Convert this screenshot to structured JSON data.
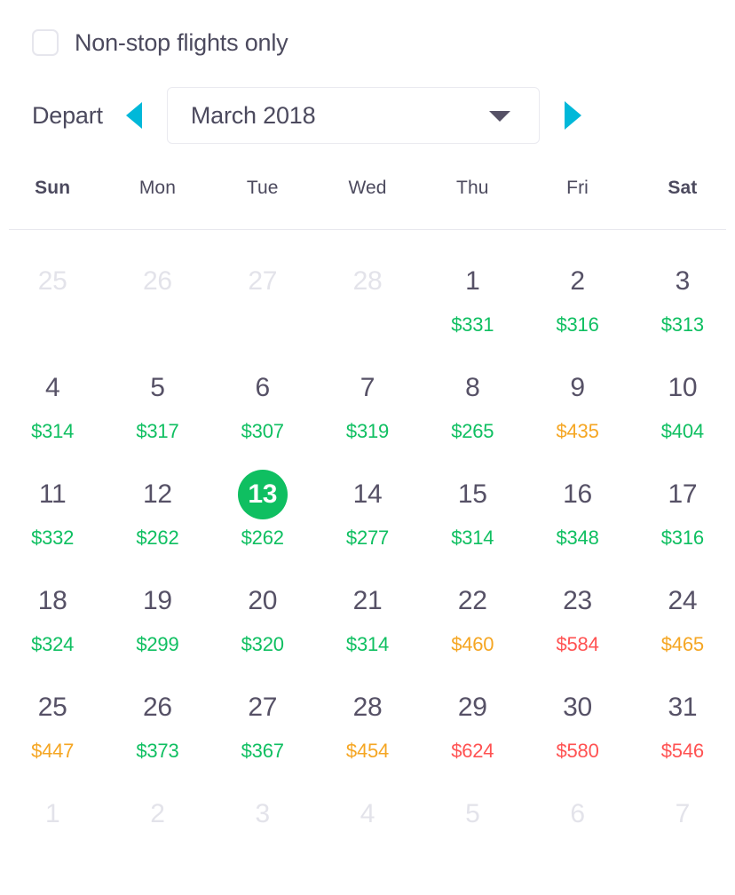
{
  "filters": {
    "nonstop": {
      "label": "Non-stop flights only",
      "checked": false
    }
  },
  "nav": {
    "depart_label": "Depart",
    "prev_icon": "triangle-left-icon",
    "next_icon": "triangle-right-icon",
    "month_value": "March 2018",
    "caret_icon": "chevron-down-icon"
  },
  "calendar": {
    "weekdays": [
      {
        "label": "Sun",
        "weekend": true
      },
      {
        "label": "Mon",
        "weekend": false
      },
      {
        "label": "Tue",
        "weekend": false
      },
      {
        "label": "Wed",
        "weekend": false
      },
      {
        "label": "Thu",
        "weekend": false
      },
      {
        "label": "Fri",
        "weekend": false
      },
      {
        "label": "Sat",
        "weekend": true
      }
    ],
    "colors": {
      "low": "#0fbf61",
      "mid": "#f5a623",
      "high": "#ff5252",
      "day": "#565166",
      "muted": "#e3e3ea",
      "selected_bg": "#0fbf61",
      "accent": "#00b8d9"
    },
    "days": [
      {
        "num": "25",
        "price": "",
        "tier": "",
        "muted": true,
        "selected": false
      },
      {
        "num": "26",
        "price": "",
        "tier": "",
        "muted": true,
        "selected": false
      },
      {
        "num": "27",
        "price": "",
        "tier": "",
        "muted": true,
        "selected": false
      },
      {
        "num": "28",
        "price": "",
        "tier": "",
        "muted": true,
        "selected": false
      },
      {
        "num": "1",
        "price": "$331",
        "tier": "low",
        "muted": false,
        "selected": false
      },
      {
        "num": "2",
        "price": "$316",
        "tier": "low",
        "muted": false,
        "selected": false
      },
      {
        "num": "3",
        "price": "$313",
        "tier": "low",
        "muted": false,
        "selected": false
      },
      {
        "num": "4",
        "price": "$314",
        "tier": "low",
        "muted": false,
        "selected": false
      },
      {
        "num": "5",
        "price": "$317",
        "tier": "low",
        "muted": false,
        "selected": false
      },
      {
        "num": "6",
        "price": "$307",
        "tier": "low",
        "muted": false,
        "selected": false
      },
      {
        "num": "7",
        "price": "$319",
        "tier": "low",
        "muted": false,
        "selected": false
      },
      {
        "num": "8",
        "price": "$265",
        "tier": "low",
        "muted": false,
        "selected": false
      },
      {
        "num": "9",
        "price": "$435",
        "tier": "mid",
        "muted": false,
        "selected": false
      },
      {
        "num": "10",
        "price": "$404",
        "tier": "low",
        "muted": false,
        "selected": false
      },
      {
        "num": "11",
        "price": "$332",
        "tier": "low",
        "muted": false,
        "selected": false
      },
      {
        "num": "12",
        "price": "$262",
        "tier": "low",
        "muted": false,
        "selected": false
      },
      {
        "num": "13",
        "price": "$262",
        "tier": "low",
        "muted": false,
        "selected": true
      },
      {
        "num": "14",
        "price": "$277",
        "tier": "low",
        "muted": false,
        "selected": false
      },
      {
        "num": "15",
        "price": "$314",
        "tier": "low",
        "muted": false,
        "selected": false
      },
      {
        "num": "16",
        "price": "$348",
        "tier": "low",
        "muted": false,
        "selected": false
      },
      {
        "num": "17",
        "price": "$316",
        "tier": "low",
        "muted": false,
        "selected": false
      },
      {
        "num": "18",
        "price": "$324",
        "tier": "low",
        "muted": false,
        "selected": false
      },
      {
        "num": "19",
        "price": "$299",
        "tier": "low",
        "muted": false,
        "selected": false
      },
      {
        "num": "20",
        "price": "$320",
        "tier": "low",
        "muted": false,
        "selected": false
      },
      {
        "num": "21",
        "price": "$314",
        "tier": "low",
        "muted": false,
        "selected": false
      },
      {
        "num": "22",
        "price": "$460",
        "tier": "mid",
        "muted": false,
        "selected": false
      },
      {
        "num": "23",
        "price": "$584",
        "tier": "high",
        "muted": false,
        "selected": false
      },
      {
        "num": "24",
        "price": "$465",
        "tier": "mid",
        "muted": false,
        "selected": false
      },
      {
        "num": "25",
        "price": "$447",
        "tier": "mid",
        "muted": false,
        "selected": false
      },
      {
        "num": "26",
        "price": "$373",
        "tier": "low",
        "muted": false,
        "selected": false
      },
      {
        "num": "27",
        "price": "$367",
        "tier": "low",
        "muted": false,
        "selected": false
      },
      {
        "num": "28",
        "price": "$454",
        "tier": "mid",
        "muted": false,
        "selected": false
      },
      {
        "num": "29",
        "price": "$624",
        "tier": "high",
        "muted": false,
        "selected": false
      },
      {
        "num": "30",
        "price": "$580",
        "tier": "high",
        "muted": false,
        "selected": false
      },
      {
        "num": "31",
        "price": "$546",
        "tier": "high",
        "muted": false,
        "selected": false
      },
      {
        "num": "1",
        "price": "",
        "tier": "",
        "muted": true,
        "selected": false
      },
      {
        "num": "2",
        "price": "",
        "tier": "",
        "muted": true,
        "selected": false
      },
      {
        "num": "3",
        "price": "",
        "tier": "",
        "muted": true,
        "selected": false
      },
      {
        "num": "4",
        "price": "",
        "tier": "",
        "muted": true,
        "selected": false
      },
      {
        "num": "5",
        "price": "",
        "tier": "",
        "muted": true,
        "selected": false
      },
      {
        "num": "6",
        "price": "",
        "tier": "",
        "muted": true,
        "selected": false
      },
      {
        "num": "7",
        "price": "",
        "tier": "",
        "muted": true,
        "selected": false
      }
    ]
  }
}
